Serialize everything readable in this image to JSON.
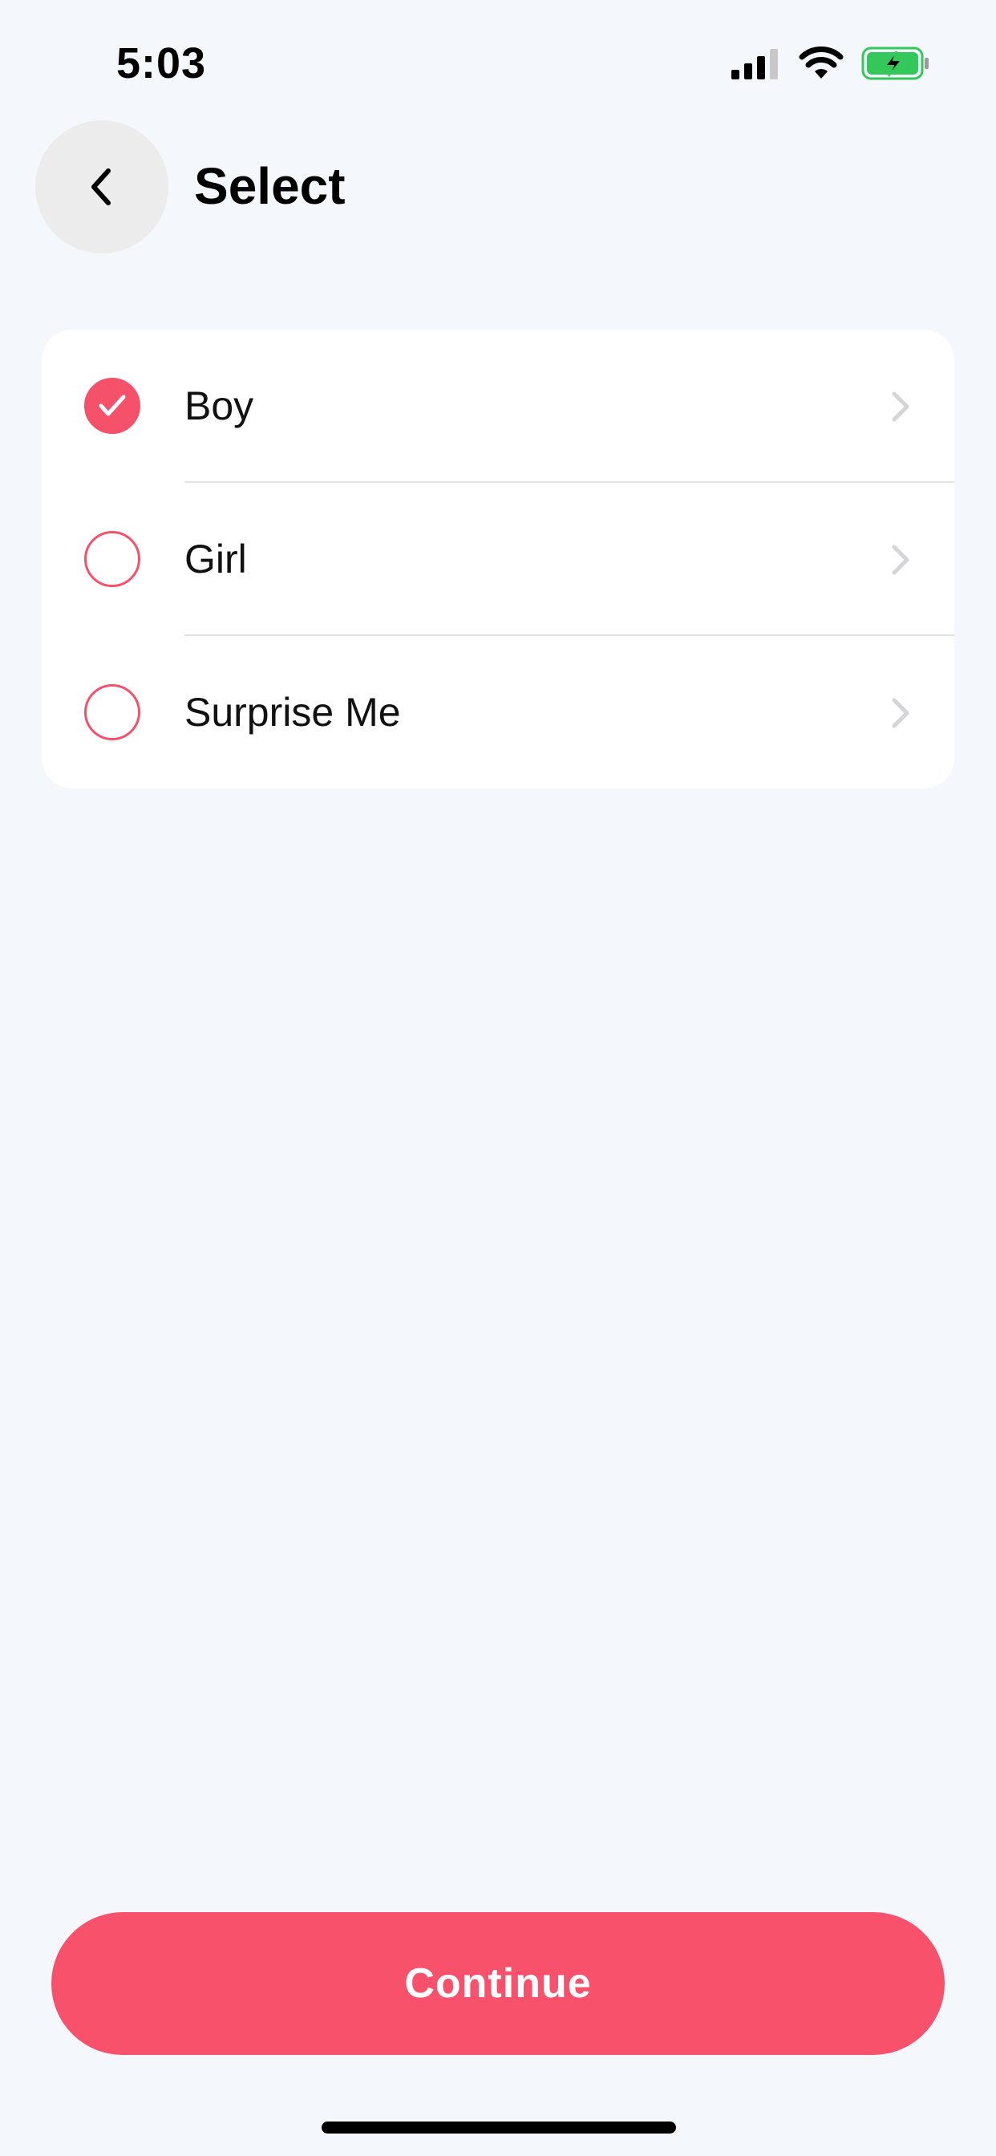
{
  "status_bar": {
    "time": "5:03",
    "icons": [
      "cellular-signal-icon",
      "wifi-icon",
      "battery-charging-icon"
    ]
  },
  "header": {
    "back_icon": "chevron-left-icon",
    "title": "Select"
  },
  "options": [
    {
      "label": "Boy",
      "selected": true
    },
    {
      "label": "Girl",
      "selected": false
    },
    {
      "label": "Surprise Me",
      "selected": false
    }
  ],
  "continue_label": "Continue",
  "colors": {
    "accent": "#f8516b",
    "background": "#f4f7fc",
    "battery_fill": "#34c759"
  }
}
